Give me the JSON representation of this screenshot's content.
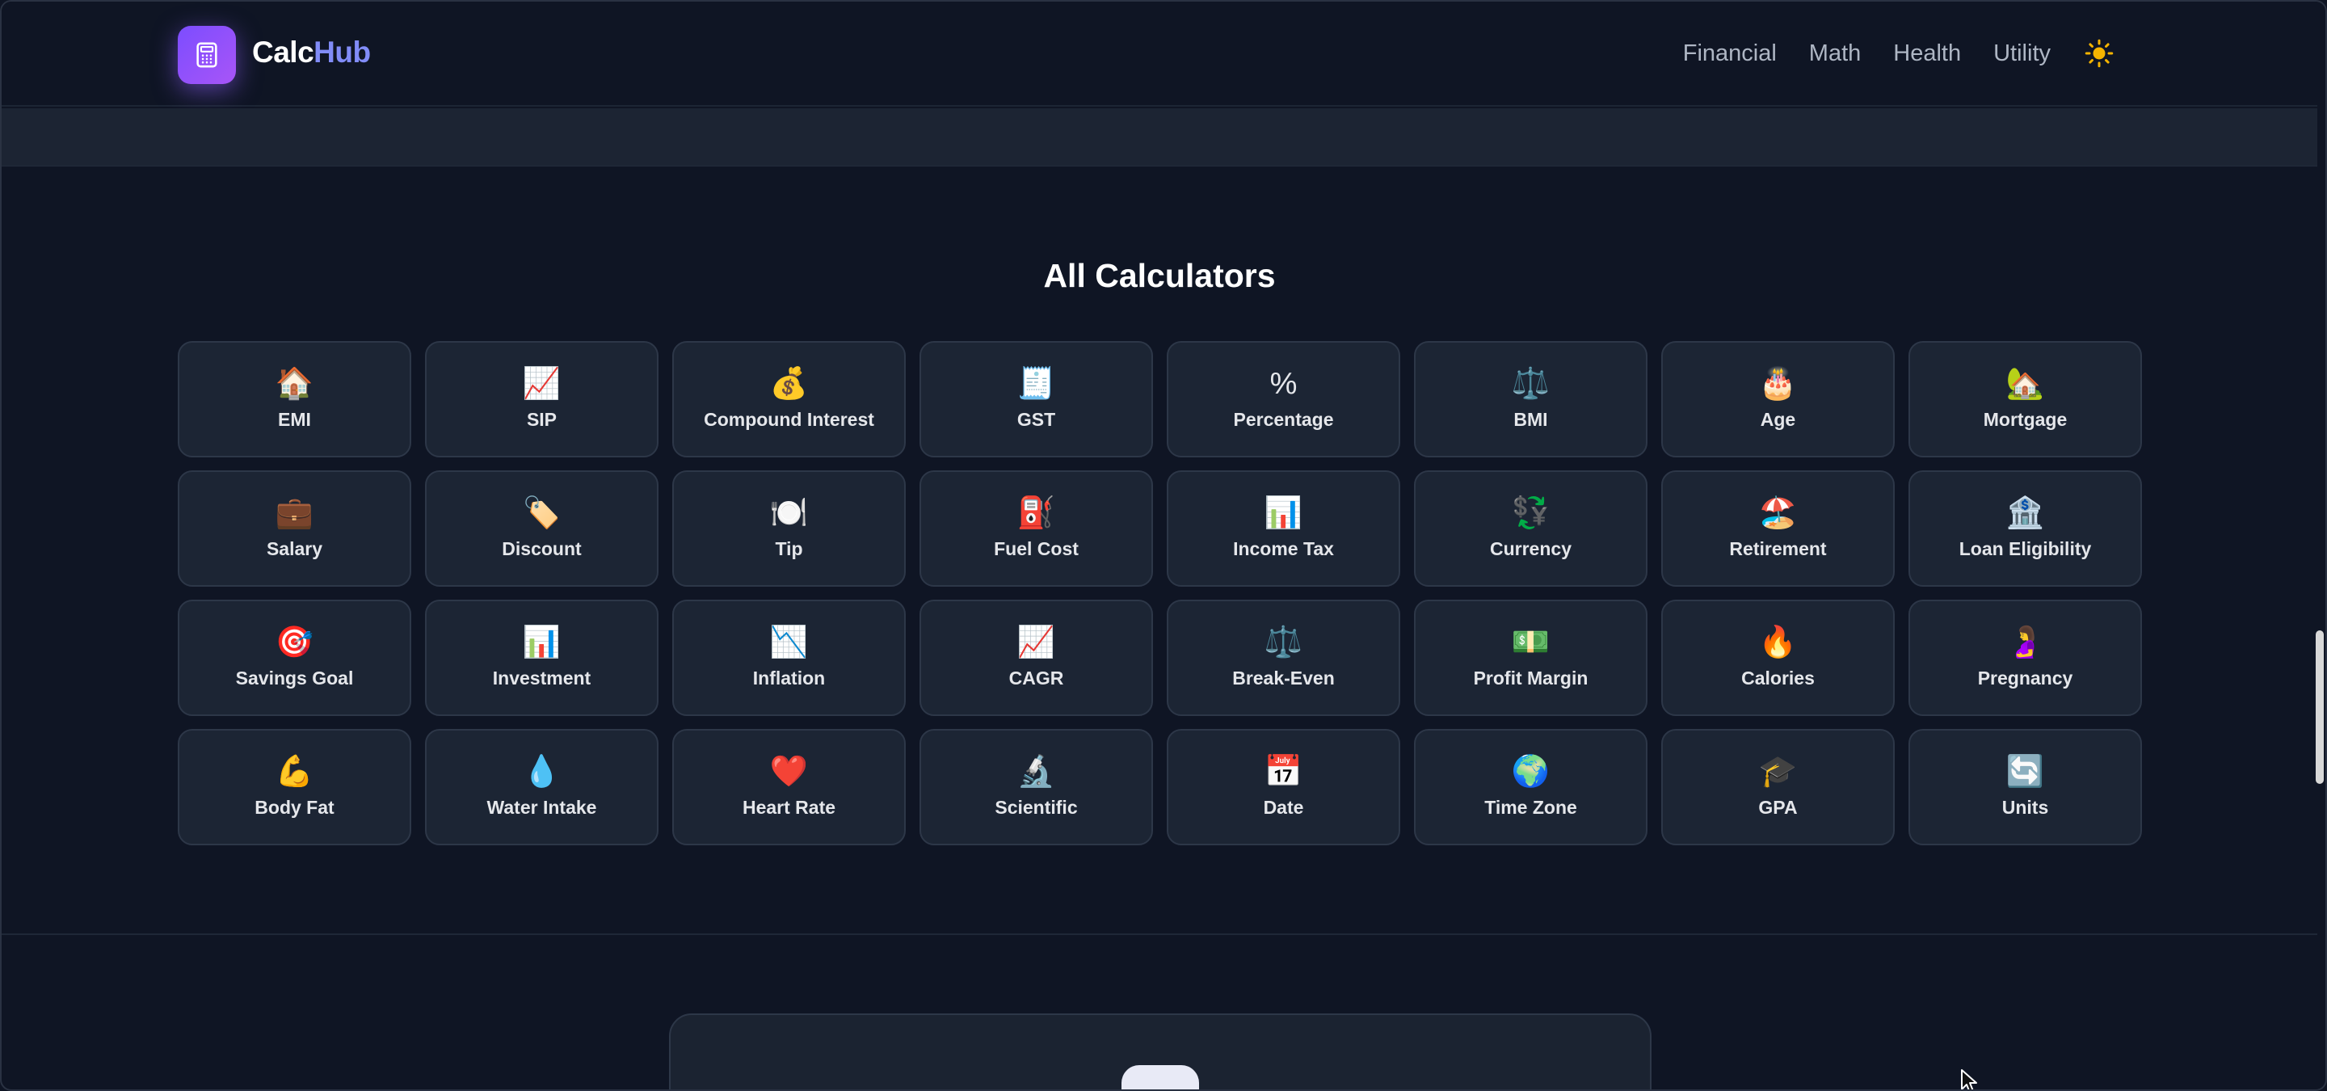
{
  "header": {
    "brand_part1": "Calc",
    "brand_part2": "Hub",
    "logo_icon": "calculator-icon",
    "nav": [
      "Financial",
      "Math",
      "Health",
      "Utility"
    ],
    "theme_icon": "☀️"
  },
  "section": {
    "title": "All Calculators"
  },
  "calculators": [
    {
      "icon": "🏠",
      "label": "EMI"
    },
    {
      "icon": "📈",
      "label": "SIP"
    },
    {
      "icon": "💰",
      "label": "Compound Interest"
    },
    {
      "icon": "🧾",
      "label": "GST"
    },
    {
      "icon": "%",
      "label": "Percentage"
    },
    {
      "icon": "⚖️",
      "label": "BMI"
    },
    {
      "icon": "🎂",
      "label": "Age"
    },
    {
      "icon": "🏡",
      "label": "Mortgage"
    },
    {
      "icon": "💼",
      "label": "Salary"
    },
    {
      "icon": "🏷️",
      "label": "Discount"
    },
    {
      "icon": "🍽️",
      "label": "Tip"
    },
    {
      "icon": "⛽",
      "label": "Fuel Cost"
    },
    {
      "icon": "📊",
      "label": "Income Tax"
    },
    {
      "icon": "💱",
      "label": "Currency"
    },
    {
      "icon": "🏖️",
      "label": "Retirement"
    },
    {
      "icon": "🏦",
      "label": "Loan Eligibility"
    },
    {
      "icon": "🎯",
      "label": "Savings Goal"
    },
    {
      "icon": "📊",
      "label": "Investment"
    },
    {
      "icon": "📉",
      "label": "Inflation"
    },
    {
      "icon": "📈",
      "label": "CAGR"
    },
    {
      "icon": "⚖️",
      "label": "Break-Even"
    },
    {
      "icon": "💵",
      "label": "Profit Margin"
    },
    {
      "icon": "🔥",
      "label": "Calories"
    },
    {
      "icon": "🤰",
      "label": "Pregnancy"
    },
    {
      "icon": "💪",
      "label": "Body Fat"
    },
    {
      "icon": "💧",
      "label": "Water Intake"
    },
    {
      "icon": "❤️",
      "label": "Heart Rate"
    },
    {
      "icon": "🔬",
      "label": "Scientific"
    },
    {
      "icon": "📅",
      "label": "Date"
    },
    {
      "icon": "🌍",
      "label": "Time Zone"
    },
    {
      "icon": "🎓",
      "label": "GPA"
    },
    {
      "icon": "🔄",
      "label": "Units"
    }
  ],
  "calculator_icon_names": [
    "house-icon",
    "chart-up-icon",
    "money-bag-icon",
    "receipt-icon",
    "percent-icon",
    "scales-icon",
    "cake-icon",
    "house-garden-icon",
    "briefcase-icon",
    "tag-icon",
    "plate-icon",
    "fuel-pump-icon",
    "bar-chart-icon",
    "currency-exchange-icon",
    "beach-icon",
    "bank-icon",
    "target-icon",
    "bar-chart-icon",
    "chart-down-icon",
    "chart-up-icon",
    "scales-icon",
    "banknote-icon",
    "fire-icon",
    "pregnant-icon",
    "flexed-arm-icon",
    "droplet-icon",
    "heart-icon",
    "microscope-icon",
    "calendar-icon",
    "globe-icon",
    "graduation-cap-icon",
    "refresh-icon"
  ],
  "colors": {
    "background": "#0f1524",
    "card": "#1c2534",
    "accent": "#818cf8",
    "logo_gradient_start": "#7c4dff",
    "logo_gradient_end": "#a855f7"
  }
}
